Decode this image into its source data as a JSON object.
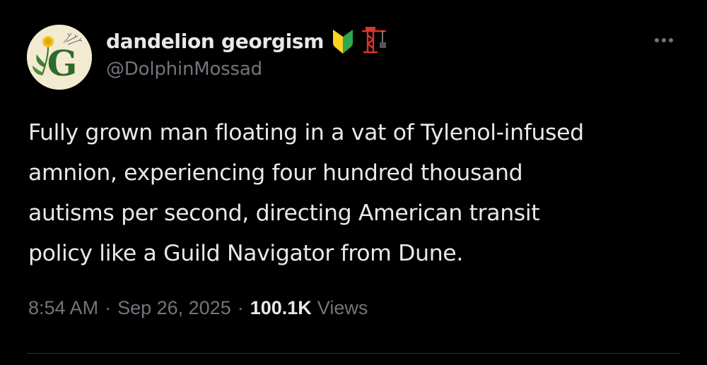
{
  "author": {
    "display_name": "dandelion georgism",
    "handle": "@DolphinMossad",
    "avatar_letter": "G",
    "name_emojis": [
      "japanese-beginner-symbol",
      "construction-crane"
    ]
  },
  "tweet": {
    "text": "Fully grown man floating in a vat of Tylenol-infused\namnion, experiencing four hundred thousand\nautisms per second, directing American transit\npolicy like a Guild Navigator from Dune."
  },
  "meta": {
    "time": "8:54 AM",
    "separator": "·",
    "date": "Sep 26, 2025",
    "views_count": "100.1K",
    "views_label": "Views"
  },
  "colors": {
    "background": "#000000",
    "primary_text": "#e7e9ea",
    "secondary_text": "#71767b",
    "divider": "#2f3336",
    "avatar_bg": "#f3ead2",
    "avatar_letter": "#2e6b2c"
  },
  "icons": {
    "more": "more-horizontal-icon"
  }
}
